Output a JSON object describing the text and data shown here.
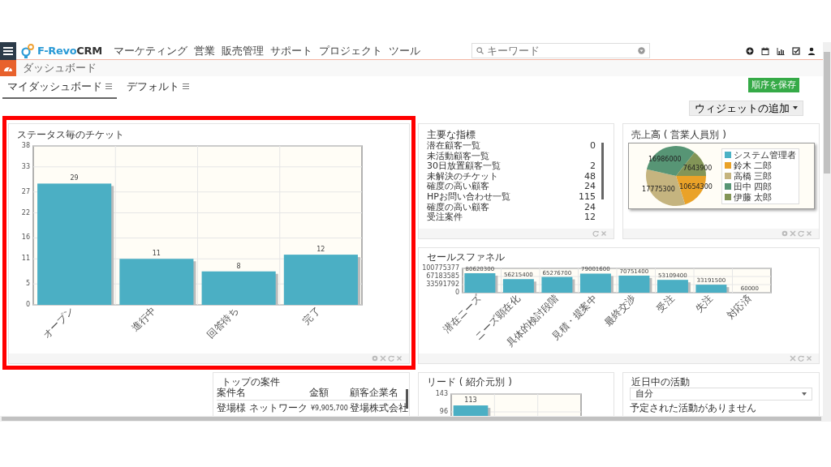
{
  "topbar": {
    "logo": {
      "primary": "F-Revo",
      "secondary": "CRM"
    },
    "menu": [
      {
        "label": "マーケティング"
      },
      {
        "label": "営業"
      },
      {
        "label": "販売管理"
      },
      {
        "label": "サポート"
      },
      {
        "label": "プロジェクト"
      },
      {
        "label": "ツール"
      }
    ],
    "search": {
      "placeholder": "キーワード"
    }
  },
  "breadcrumb": {
    "title": "ダッシュボード"
  },
  "tabs": [
    {
      "label": "マイダッシュボード",
      "selected": true
    },
    {
      "label": "デフォルト",
      "selected": false
    }
  ],
  "save_button": "順序を保存",
  "add_widget_button": "ウィジェットの追加",
  "widgets": [
    {
      "kind": "bar_chart",
      "highlighted": true,
      "title": "ステータス毎のチケット",
      "chart_data": {
        "type": "bar",
        "categories": [
          "オープン",
          "進行中",
          "回答待ち",
          "完了"
        ],
        "values": [
          29,
          11,
          8,
          12
        ],
        "grid": true,
        "ylim": [
          0,
          38
        ],
        "yticks": [
          0,
          5,
          11,
          16,
          22,
          27,
          33,
          38
        ],
        "data_labels": true
      }
    },
    {
      "kind": "metrics",
      "highlighted": false,
      "title": "主要な指標",
      "items": [
        {
          "label": "潜在顧客一覧",
          "count": "0"
        },
        {
          "label": "未活動顧客一覧"
        },
        {
          "label": "30日放置顧客一覧",
          "count": "2"
        },
        {
          "label": "未解決のチケット",
          "count": "48"
        },
        {
          "label": "確度の高い顧客",
          "count": "24"
        },
        {
          "label": "HPお問い合わせ一覧",
          "count": "115"
        },
        {
          "label": "確度の高い顧客",
          "count": "24"
        },
        {
          "label": "受注案件",
          "count": "12"
        }
      ]
    },
    {
      "kind": "pie_chart",
      "highlighted": false,
      "title": "売上高 ( 営業人員別 )",
      "chart_data": {
        "type": "pie",
        "categories": [
          "システム管理者",
          "鈴木 二郎",
          "高橋 三郎",
          "田中 四郎",
          "伊藤 太郎"
        ],
        "values": [
          null,
          10654300,
          17775300,
          16986000,
          7643900
        ],
        "data_labels": true
      }
    },
    {
      "kind": "funnel",
      "highlighted": false,
      "title": "セールスファネル",
      "chart_data": {
        "type": "bar",
        "categories": [
          "潜在ニーズ",
          "ニーズ顕在化",
          "具体的検討段階",
          "見積・提案中",
          "最終交渉",
          "受注",
          "失注",
          "対応済"
        ],
        "values": [
          80620300,
          56215400,
          65276700,
          79001600,
          70751400,
          53109400,
          33191500,
          60000
        ],
        "grid": true,
        "ylim": [
          0,
          100775377
        ],
        "yticks": [
          0,
          33591792,
          67183585,
          100775377
        ],
        "data_labels": true
      }
    },
    {
      "kind": "table",
      "highlighted": false,
      "title": "トップの案件",
      "columns": [
        "案件名",
        "金額",
        "顧客企業名"
      ],
      "rows": [
        [
          "登場様 ネットワーク",
          "¥9,905,700",
          "登場株式会社"
        ]
      ]
    },
    {
      "kind": "lead_chart",
      "highlighted": false,
      "title": "リード ( 紹介元別 )",
      "chart_data": {
        "type": "bar",
        "values": [
          113
        ],
        "grid": true,
        "ylim": [
          0,
          143
        ],
        "yticks": [
          96,
          143
        ],
        "data_labels": true
      }
    },
    {
      "kind": "activities",
      "highlighted": false,
      "title": "近日中の活動",
      "filter": "自分",
      "message": "予定された活動がありません"
    }
  ]
}
